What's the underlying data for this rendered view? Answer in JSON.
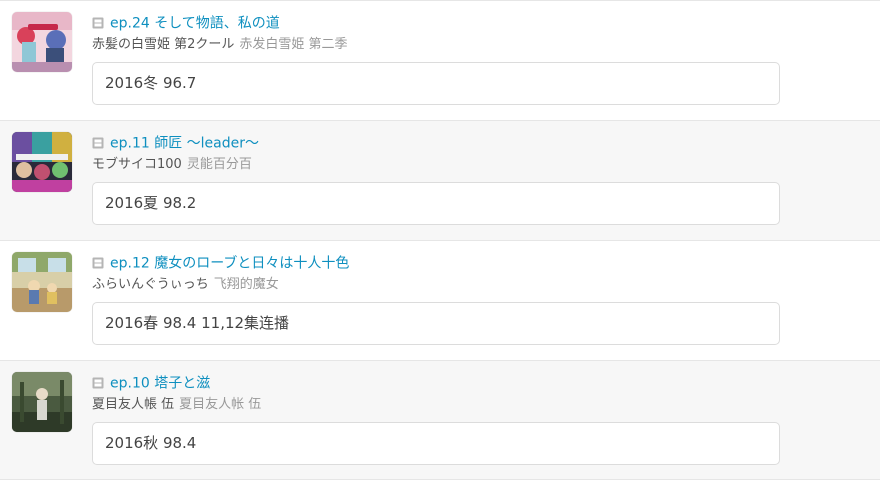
{
  "entries": [
    {
      "episode_title": "ep.24 そして物語、私の道",
      "series_name": "赤髪の白雪姫 第2クール",
      "series_name_cn": "赤发白雪姫 第二季",
      "comment": "2016冬 96.7",
      "thumbnail_icon": "anime-cover-thumbnail"
    },
    {
      "episode_title": "ep.11 師匠 ～leader～",
      "series_name": "モブサイコ100",
      "series_name_cn": "灵能百分百",
      "comment": "2016夏 98.2",
      "thumbnail_icon": "anime-cover-thumbnail"
    },
    {
      "episode_title": "ep.12 魔女のローブと日々は十人十色",
      "series_name": "ふらいんぐうぃっち",
      "series_name_cn": "飞翔的魔女",
      "comment": "2016春 98.4 11,12集连播",
      "thumbnail_icon": "anime-cover-thumbnail"
    },
    {
      "episode_title": "ep.10 塔子と滋",
      "series_name": "夏目友人帳 伍",
      "series_name_cn": "夏目友人帐 伍",
      "comment": "2016秋 98.4",
      "thumbnail_icon": "anime-cover-thumbnail"
    }
  ],
  "colors": {
    "link": "#0e8fbf",
    "alt_row_bg": "#f7f7f7",
    "border": "#e6e6e6"
  }
}
